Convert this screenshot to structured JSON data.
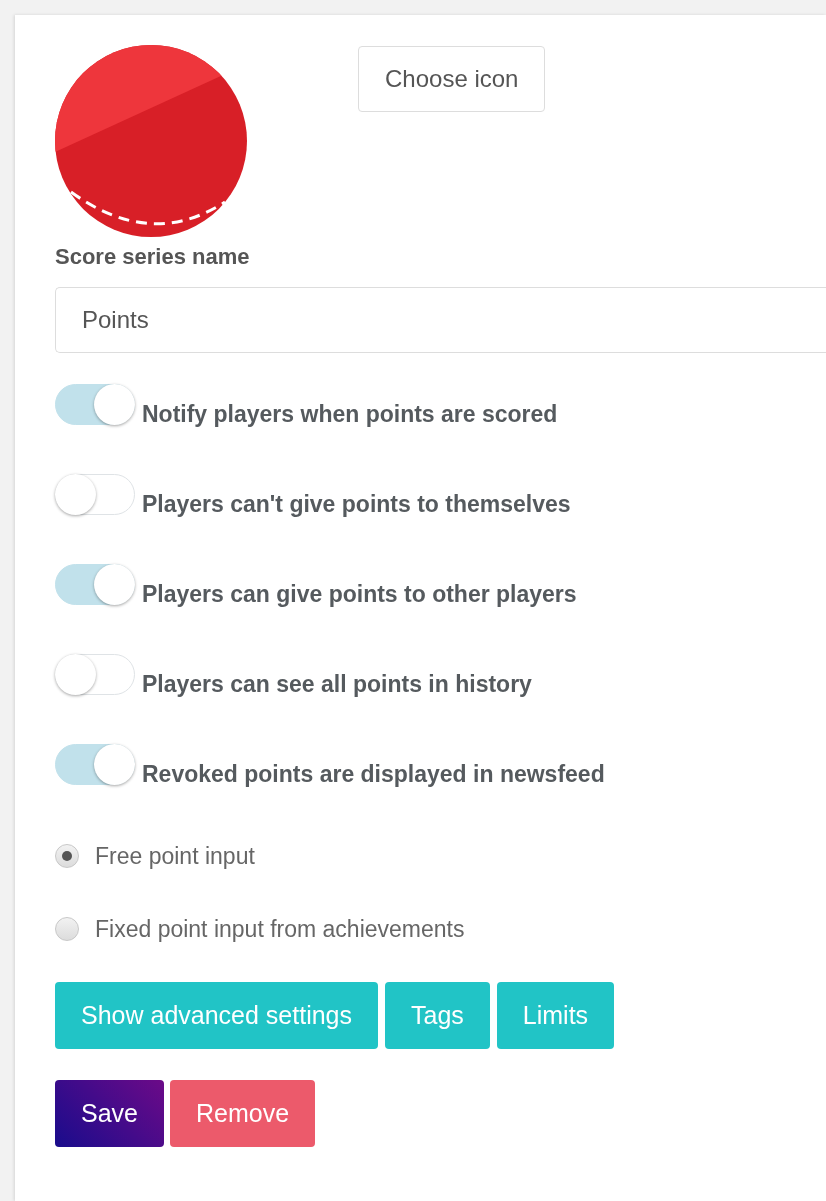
{
  "icon_button": {
    "label": "Choose icon"
  },
  "name_field": {
    "label": "Score series name",
    "value": "Points"
  },
  "toggles": [
    {
      "label": "Notify players when points are scored",
      "on": true
    },
    {
      "label": "Players can't give points to themselves",
      "on": false
    },
    {
      "label": "Players can give points to other players",
      "on": true
    },
    {
      "label": "Players can see all points in history",
      "on": false
    },
    {
      "label": "Revoked points are displayed in newsfeed",
      "on": true
    }
  ],
  "point_input": [
    {
      "label": "Free point input",
      "selected": true
    },
    {
      "label": "Fixed point input from achievements",
      "selected": false
    }
  ],
  "option_buttons": [
    {
      "label": "Show advanced settings",
      "kind": "secondary"
    },
    {
      "label": "Tags",
      "kind": "secondary"
    },
    {
      "label": "Limits",
      "kind": "secondary"
    }
  ],
  "form_buttons": [
    {
      "label": "Save",
      "kind": "primary"
    },
    {
      "label": "Remove",
      "kind": "danger"
    }
  ]
}
